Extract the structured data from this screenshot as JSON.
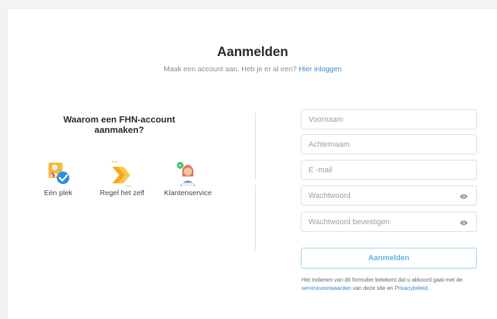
{
  "header": {
    "title": "Aanmelden",
    "subtitle_text": "Maak een account aan. Heb je er al een?",
    "login_link": "Hier inloggen"
  },
  "why": {
    "heading_line1": "Waarom een FHN-account",
    "heading_line2": "aanmaken?",
    "features": [
      {
        "label": "Eén plek",
        "icon": "user-checkmark-icon"
      },
      {
        "label": "Regel het zelf",
        "icon": "arrow-chevrons-icon"
      },
      {
        "label": "Klantenservice",
        "icon": "support-agent-icon"
      }
    ]
  },
  "form": {
    "first_name_placeholder": "Voornaam",
    "last_name_placeholder": "Achternaam",
    "email_placeholder": "E -mail",
    "password_placeholder": "Wachtwoord",
    "password_confirm_placeholder": "Wachtwoord bevestigen",
    "submit_label": "Aanmelden"
  },
  "legal": {
    "text_1": "Het indienen van dit formulier betekent dat u akkoord gaat met de",
    "terms_link": "servicevoorwaarden",
    "text_2": "van deze site en",
    "privacy_link": "Privacybeleid",
    "text_3": "."
  },
  "colors": {
    "accent": "#3b86c9",
    "button_border": "#9ccfee",
    "button_text": "#62b4e4"
  }
}
